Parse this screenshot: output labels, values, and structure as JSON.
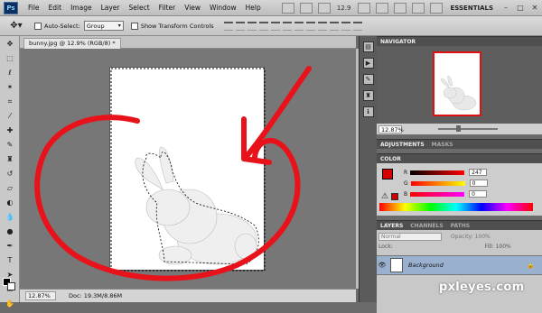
{
  "menubar": {
    "logo": "Ps",
    "items": [
      "File",
      "Edit",
      "Image",
      "Layer",
      "Select",
      "Filter",
      "View",
      "Window",
      "Help"
    ],
    "zoom": "12.9",
    "workspace": "ESSENTIALS",
    "window_buttons": [
      "–",
      "□",
      "✕"
    ]
  },
  "options": {
    "auto_select_label": "Auto-Select:",
    "auto_select_value": "Group",
    "show_transform_label": "Show Transform Controls"
  },
  "document": {
    "tab_title": "bunny.jpg @ 12.9% (RGB/8) *",
    "zoom": "12.87%",
    "doc_size": "Doc: 19.3M/8.86M"
  },
  "panels": {
    "navigator": {
      "title": "NAVIGATOR",
      "zoom": "12.87%"
    },
    "adjustments": {
      "tabs": [
        "ADJUSTMENTS",
        "MASKS"
      ]
    },
    "color": {
      "title": "COLOR",
      "channels": [
        {
          "label": "R",
          "value": "247"
        },
        {
          "label": "G",
          "value": "0"
        },
        {
          "label": "B",
          "value": "0"
        }
      ],
      "fg_color": "#d60000"
    },
    "layers": {
      "tabs": [
        "LAYERS",
        "CHANNELS",
        "PATHS"
      ],
      "blend": "Normal",
      "opacity": "Opacity: 100%",
      "lock": "Lock:",
      "fill": "Fill: 100%",
      "layer_name": "Background"
    }
  },
  "watermark": "pxleyes.com",
  "accent": "#e8131a"
}
